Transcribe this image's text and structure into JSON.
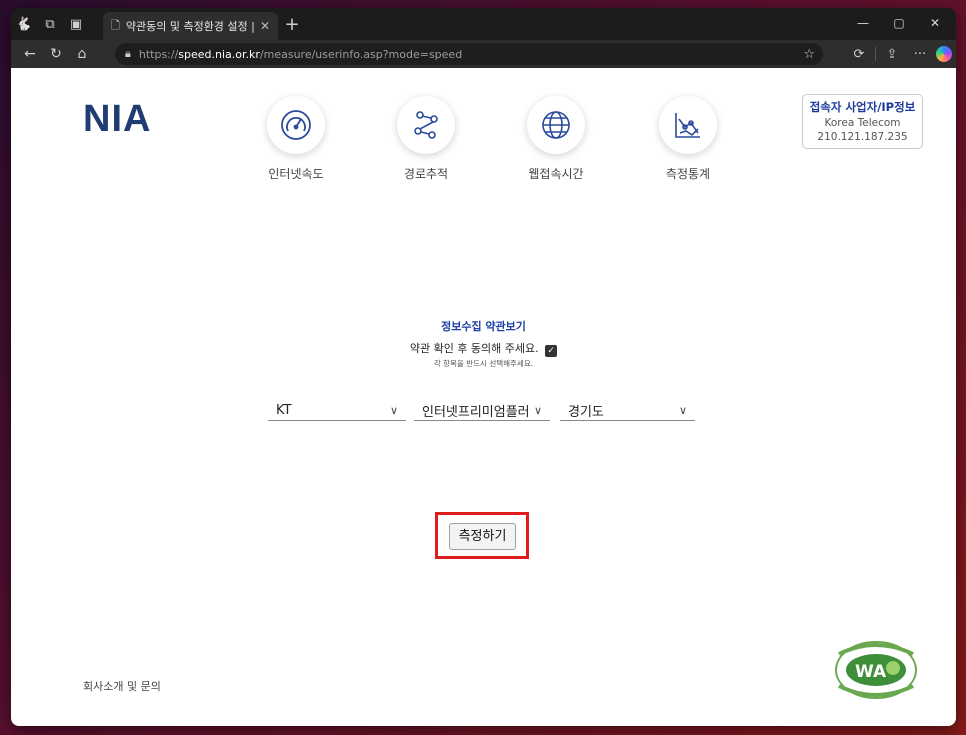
{
  "browser": {
    "tab_title": "약관동의 및 측정환경 설정 | 인터",
    "url_prefix": "https://",
    "url_host": "speed.nia.or.kr",
    "url_path": "/measure/userinfo.asp?mode=speed"
  },
  "site": {
    "logo": "NIA",
    "nav": [
      {
        "label": "인터넷속도",
        "icon": "speedometer-icon"
      },
      {
        "label": "경로추적",
        "icon": "route-trace-icon"
      },
      {
        "label": "웹접속시간",
        "icon": "globe-icon"
      },
      {
        "label": "측정통계",
        "icon": "statistics-icon"
      }
    ],
    "ip_info": {
      "title": "접속자 사업자/IP정보",
      "isp": "Korea Telecom",
      "ip": "210.121.187.235"
    }
  },
  "form": {
    "terms_title": "정보수집 약관보기",
    "agree_text": "약관 확인 후 동의해 주세요.",
    "agree_checked": true,
    "agree_note": "각 항목을 반드시 선택해주세요.",
    "isp_select": "KT",
    "product_select": "인터넷프리미엄플러",
    "region_select": "경기도",
    "submit_label": "측정하기"
  },
  "footer": {
    "link": "회사소개 및 문의",
    "badge": "WA"
  },
  "colors": {
    "logo": "#1f3c73",
    "accent": "#1e40a8",
    "highlight": "#e01b1b"
  }
}
